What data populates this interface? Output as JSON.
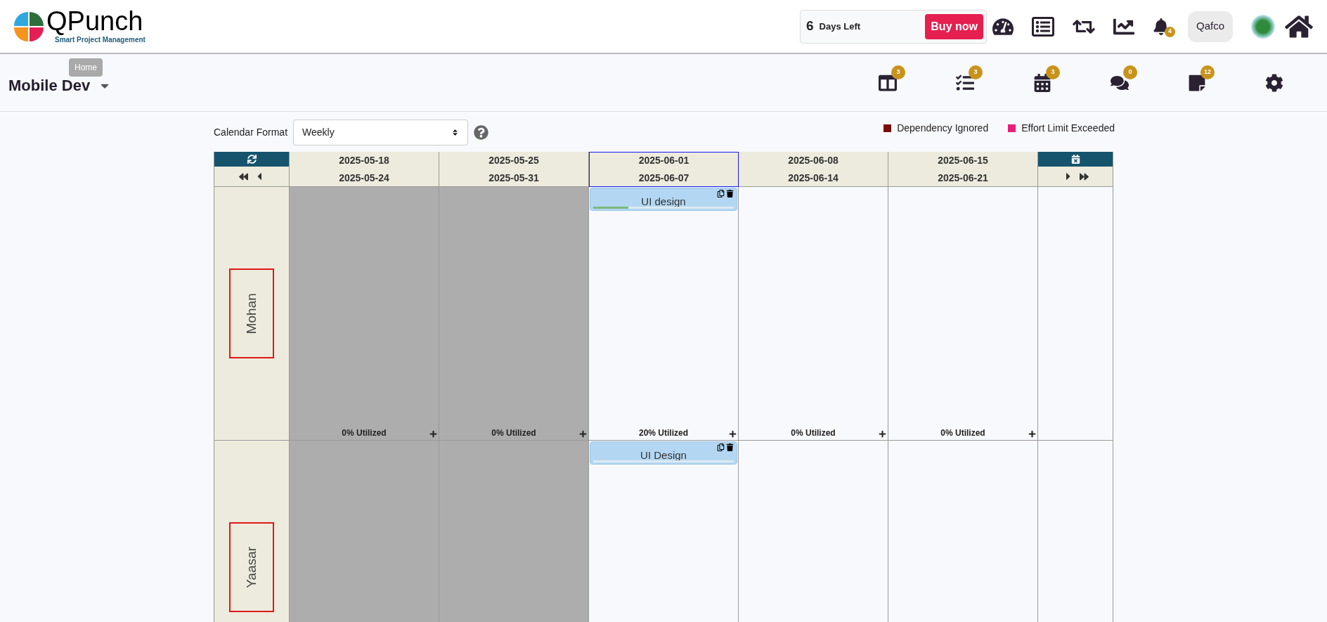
{
  "logo": {
    "name": "QPunch",
    "tagline": "Smart Project Management"
  },
  "tooltip": "Home",
  "trial": {
    "days": "6",
    "label": "Days Left",
    "button": "Buy now"
  },
  "notifications": {
    "count": "4"
  },
  "company": "Qafco",
  "project": {
    "title": "Mobile Dev"
  },
  "toolbar": [
    {
      "kind": "board",
      "count": "3"
    },
    {
      "kind": "bars",
      "count": "3"
    },
    {
      "kind": "calendar",
      "count": "3"
    },
    {
      "kind": "chat",
      "count": "0"
    },
    {
      "kind": "note",
      "count": "12"
    },
    {
      "kind": "settings"
    }
  ],
  "calendar_format": {
    "label": "Calendar Format",
    "value": "Weekly"
  },
  "legend": [
    {
      "label": "Dependency Ignored",
      "color": "#7b0c0c"
    },
    {
      "label": "Effort Limit Exceeded",
      "color": "#e91e7a"
    }
  ],
  "weeks": [
    {
      "start": "2025-05-18",
      "end": "2025-05-24",
      "selected": false,
      "past": true
    },
    {
      "start": "2025-05-25",
      "end": "2025-05-31",
      "selected": false,
      "past": true
    },
    {
      "start": "2025-06-01",
      "end": "2025-06-07",
      "selected": true,
      "past": false
    },
    {
      "start": "2025-06-08",
      "end": "2025-06-14",
      "selected": false,
      "past": false
    },
    {
      "start": "2025-06-15",
      "end": "2025-06-21",
      "selected": false,
      "past": false
    }
  ],
  "resources": [
    {
      "name": "Mohan",
      "cells": [
        {
          "utilization": "0% Utilized"
        },
        {
          "utilization": "0% Utilized"
        },
        {
          "utilization": "20% Utilized",
          "task": {
            "title": "UI design",
            "level": 0.25
          }
        },
        {
          "utilization": "0% Utilized"
        },
        {
          "utilization": "0% Utilized"
        }
      ]
    },
    {
      "name": "Yaasar",
      "cells": [
        {},
        {},
        {
          "task": {
            "title": "UI Design",
            "level": 0
          }
        },
        {},
        {}
      ]
    }
  ]
}
